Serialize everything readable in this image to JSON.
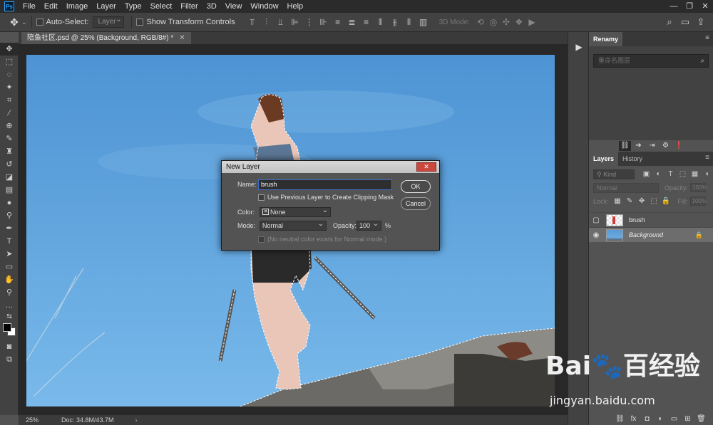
{
  "menu": {
    "logo": "Ps",
    "items": [
      "File",
      "Edit",
      "Image",
      "Layer",
      "Type",
      "Select",
      "Filter",
      "3D",
      "View",
      "Window",
      "Help"
    ],
    "window_controls": [
      "—",
      "❐",
      "✕"
    ]
  },
  "options": {
    "auto_select_label": "Auto-Select:",
    "auto_select_value": "Layer",
    "transform_label": "Show Transform Controls",
    "mode_3d_label": "3D Mode:"
  },
  "document": {
    "tab_title": "陪鱼社区.psd @ 25% (Background, RGB/8#) *",
    "zoom": "25%",
    "doc_size": "Doc: 34.8M/43.7M"
  },
  "renamy": {
    "title": "Renamy",
    "search_placeholder": "重命名图层"
  },
  "layers": {
    "tabs": [
      "Layers",
      "History"
    ],
    "kind_label": "Kind",
    "blend_mode": "Normal",
    "opacity_label": "Opacity:",
    "opacity_value": "100%",
    "lock_label": "Lock:",
    "fill_label": "Fill:",
    "fill_value": "100%",
    "items": [
      {
        "name": "brush",
        "visible": false,
        "selected": false
      },
      {
        "name": "Background",
        "visible": true,
        "selected": true,
        "locked": true
      }
    ]
  },
  "dialog": {
    "title": "New Layer",
    "name_label": "Name:",
    "name_value": "brush",
    "clipping_label": "Use Previous Layer to Create Clipping Mask",
    "color_label": "Color:",
    "color_value": "None",
    "mode_label": "Mode:",
    "mode_value": "Normal",
    "opacity_label": "Opacity:",
    "opacity_value": "100",
    "percent": "%",
    "neutral_label": "(No neutral color exists for Normal mode.)",
    "ok_label": "OK",
    "cancel_label": "Cancel"
  },
  "watermark": {
    "logo": "Bai🐾百经验",
    "url": "jingyan.baidu.com"
  },
  "colors": {
    "sky": "#5ea2dc",
    "panel": "#535353",
    "accent": "#31a8ff"
  }
}
